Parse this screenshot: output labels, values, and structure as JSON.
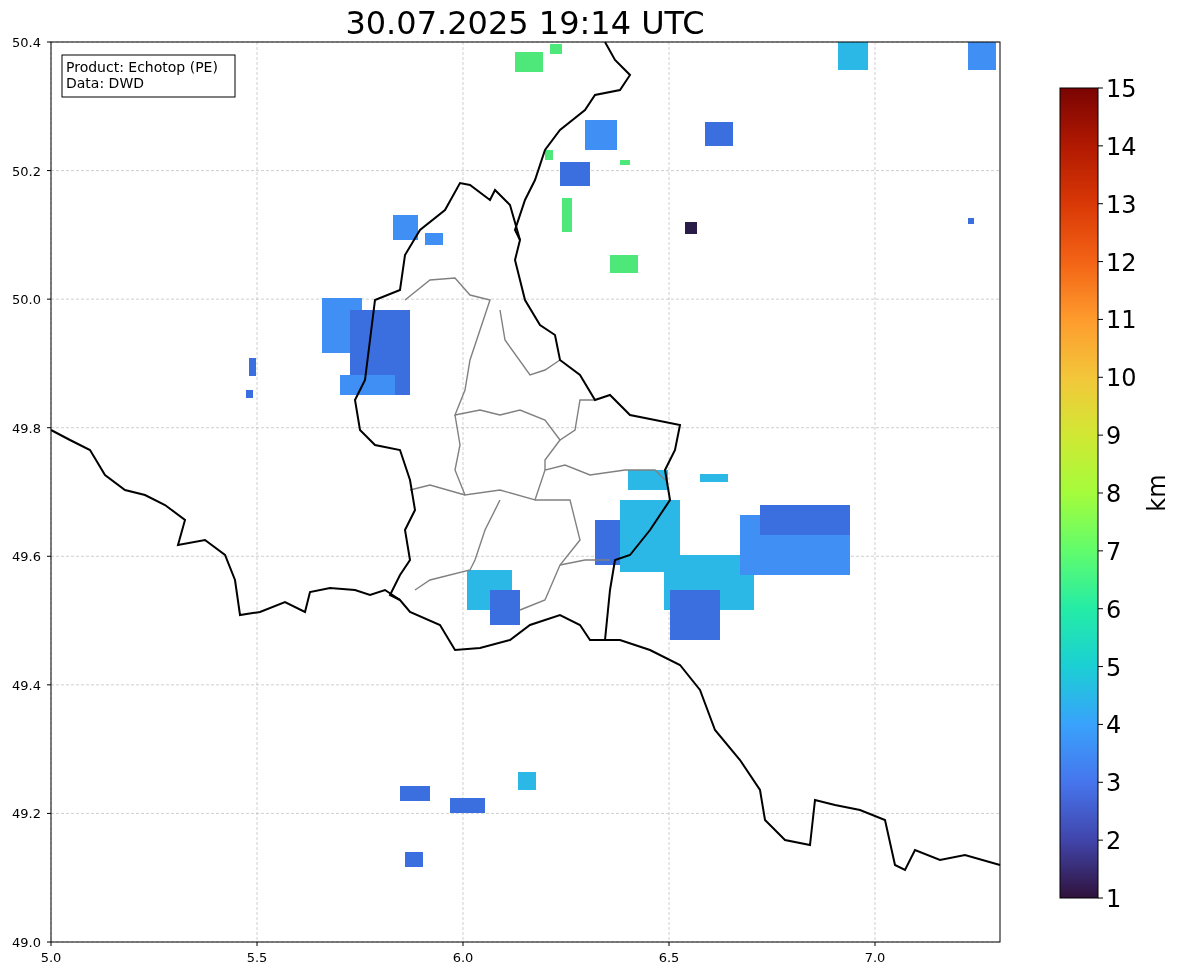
{
  "title": "30.07.2025 19:14 UTC",
  "info_box": {
    "lines": [
      "Product: Echotop (PE)",
      "Data: DWD"
    ]
  },
  "map": {
    "x_ticks": [
      "5.0",
      "5.5",
      "6.0",
      "6.5",
      "7.0"
    ],
    "y_ticks": [
      "50.4",
      "50.2",
      "50.0",
      "49.8",
      "49.6",
      "49.4",
      "49.2",
      "49.0"
    ]
  },
  "colorbar": {
    "ticks": [
      "15",
      "14",
      "13",
      "12",
      "11",
      "10",
      "9",
      "8",
      "7",
      "6",
      "5",
      "4",
      "3",
      "2",
      "1"
    ],
    "label": "km"
  }
}
